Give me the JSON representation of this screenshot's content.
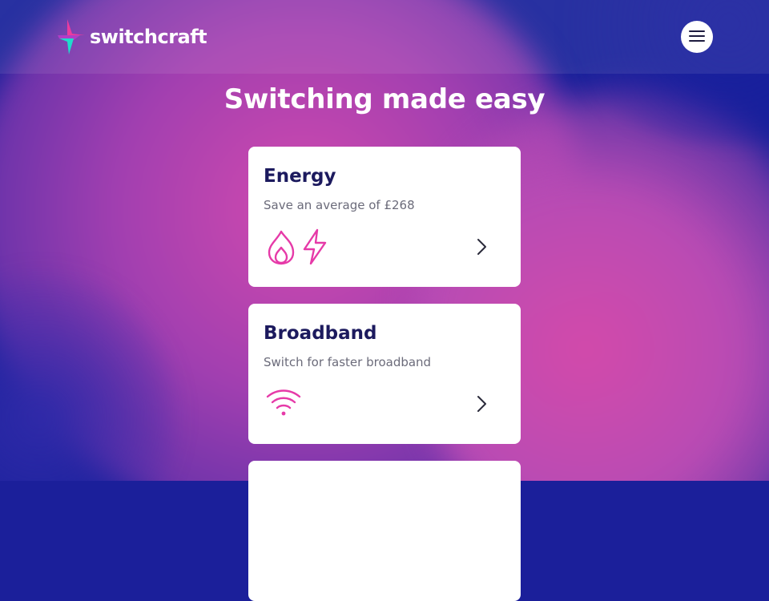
{
  "brand": {
    "name": "switchcraft",
    "colors": {
      "accent_pink": "#e63aa8",
      "accent_cyan": "#1de0d0",
      "navy": "#1c1a5e"
    }
  },
  "header": {
    "menu_icon": "hamburger-menu-icon"
  },
  "hero": {
    "headline": "Switching made easy"
  },
  "cards": [
    {
      "title": "Energy",
      "subtitle": "Save an average of £268",
      "icons": [
        "flame-icon",
        "lightning-bolt-icon"
      ]
    },
    {
      "title": "Broadband",
      "subtitle": "Switch for faster broadband",
      "icons": [
        "wifi-icon"
      ]
    }
  ]
}
